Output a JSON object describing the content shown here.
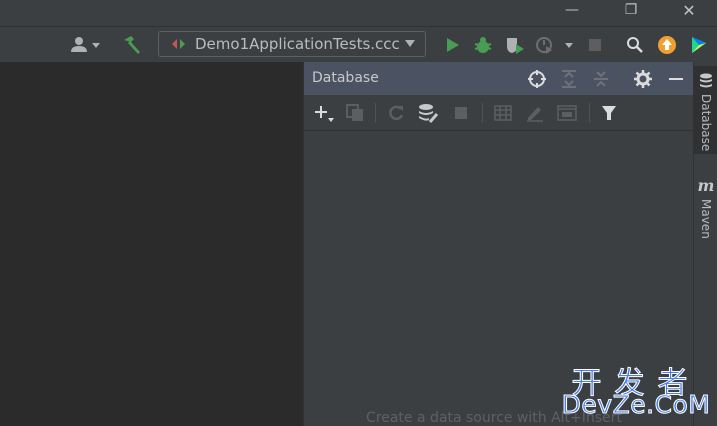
{
  "window_controls": {
    "minimize": "—",
    "restore": "❐",
    "close": "✕"
  },
  "toolbar": {
    "run_configuration": "Demo1ApplicationTests.ccc",
    "icons": [
      "user-icon",
      "build-hammer-icon",
      "run-icon",
      "debug-icon",
      "coverage-icon",
      "profile-icon",
      "stop-icon",
      "search-icon",
      "update-icon",
      "toolbox-icon"
    ]
  },
  "database_panel": {
    "title": "Database",
    "empty_message": "Create a data source with Alt+Insert",
    "header_icons": [
      "crosshair-icon",
      "expand-all-icon",
      "collapse-all-icon",
      "gear-icon",
      "hide-icon"
    ],
    "toolbar_icons": [
      "add-icon",
      "duplicate-icon",
      "refresh-icon",
      "sync-schema-icon",
      "stop-icon",
      "table-icon",
      "edit-icon",
      "console-icon",
      "filter-icon"
    ]
  },
  "right_stripe": {
    "tabs": [
      {
        "label": "Database",
        "icon": "database-icon",
        "active": true
      },
      {
        "label": "Maven",
        "icon": "maven-icon",
        "active": false
      }
    ],
    "maven_glyph": "m"
  },
  "watermark": {
    "line1": "开发者",
    "line2": "DevZe.CoM"
  },
  "colors": {
    "run_green": "#499c54",
    "update_orange": "#f0a030",
    "panel_header": "#4b5362",
    "watermark_blue": "#4a7fe8"
  }
}
